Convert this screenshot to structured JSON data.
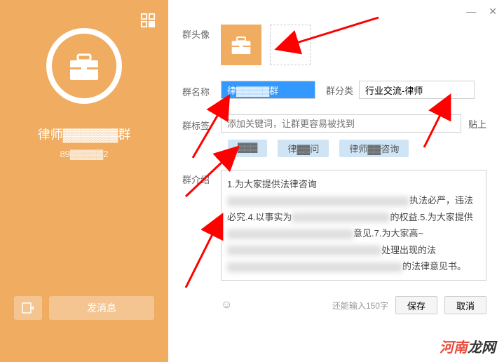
{
  "window": {
    "minimize": "—",
    "close": "✕"
  },
  "left": {
    "group_name": "律师▓▓▓▓▓▓群",
    "group_id": "89▓▓▓▓▓2",
    "send_message": "发消息"
  },
  "labels": {
    "avatar": "群头像",
    "name": "群名称",
    "category": "群分类",
    "tags": "群标签",
    "intro": "群介绍"
  },
  "form": {
    "name_value": "律▓▓▓▓▓群",
    "category_value": "行业交流-律师",
    "tag_placeholder": "添加关键词，让群更容易被找到",
    "paste": "贴上"
  },
  "tags": {
    "t1": "▓▓▓",
    "t2": "律▓▓问",
    "t3": "律师▓▓咨询"
  },
  "intro": {
    "p1a": "1.为大家提供法律咨询",
    "p1b": "执法必严，违法必究.4.以事实为",
    "p1c": "的权益.5.为大家提供",
    "p1d": "意见.7.为大家高~",
    "p1e": "处理出现的法",
    "p1f": "的法律意见书。"
  },
  "footer": {
    "char_count": "还能输入150字",
    "save": "保存",
    "cancel": "取消"
  },
  "watermark": {
    "red": "河南",
    "black": "龙网"
  }
}
